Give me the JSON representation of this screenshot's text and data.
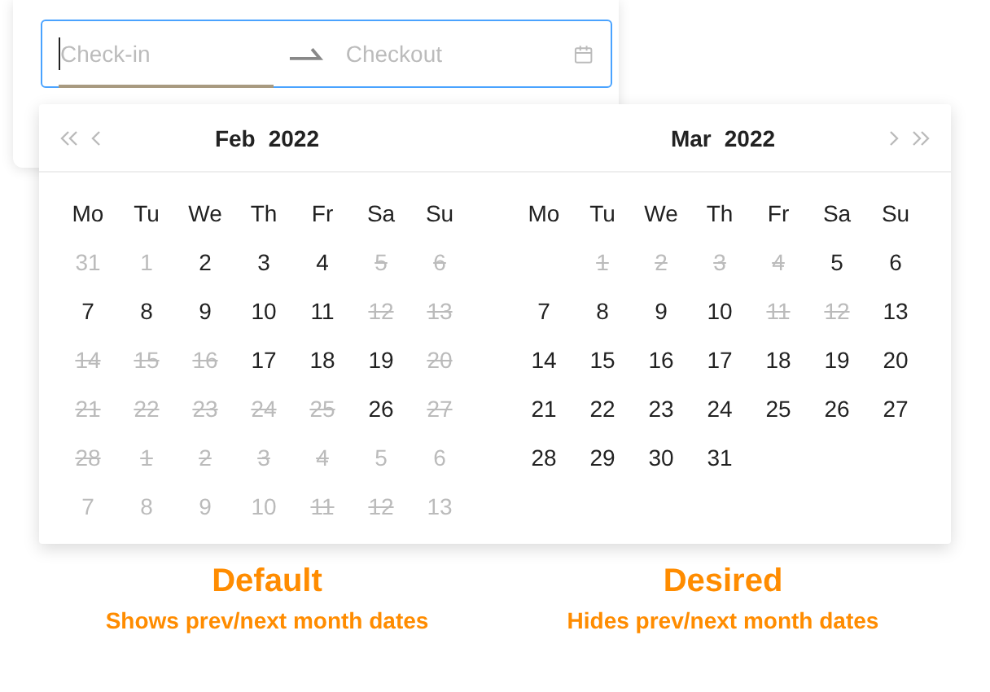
{
  "range_picker": {
    "start": {
      "placeholder": "Check-in",
      "focused": true
    },
    "end": {
      "placeholder": "Checkout",
      "focused": false
    }
  },
  "calendars": [
    {
      "month": "Feb",
      "year": "2022",
      "show_prev": true,
      "weekdays": [
        "Mo",
        "Tu",
        "We",
        "Th",
        "Fr",
        "Sa",
        "Su"
      ],
      "weeks": [
        [
          {
            "text": "31",
            "muted": true,
            "disabled": false
          },
          {
            "text": "1",
            "muted": true,
            "disabled": false
          },
          {
            "text": "2",
            "muted": false,
            "disabled": false
          },
          {
            "text": "3",
            "muted": false,
            "disabled": false
          },
          {
            "text": "4",
            "muted": false,
            "disabled": false
          },
          {
            "text": "5",
            "muted": true,
            "disabled": true
          },
          {
            "text": "6",
            "muted": true,
            "disabled": true
          }
        ],
        [
          {
            "text": "7",
            "muted": false,
            "disabled": false
          },
          {
            "text": "8",
            "muted": false,
            "disabled": false
          },
          {
            "text": "9",
            "muted": false,
            "disabled": false
          },
          {
            "text": "10",
            "muted": false,
            "disabled": false
          },
          {
            "text": "11",
            "muted": false,
            "disabled": false
          },
          {
            "text": "12",
            "muted": true,
            "disabled": true
          },
          {
            "text": "13",
            "muted": true,
            "disabled": true
          }
        ],
        [
          {
            "text": "14",
            "muted": true,
            "disabled": true
          },
          {
            "text": "15",
            "muted": true,
            "disabled": true
          },
          {
            "text": "16",
            "muted": true,
            "disabled": true
          },
          {
            "text": "17",
            "muted": false,
            "disabled": false
          },
          {
            "text": "18",
            "muted": false,
            "disabled": false
          },
          {
            "text": "19",
            "muted": false,
            "disabled": false
          },
          {
            "text": "20",
            "muted": true,
            "disabled": true
          }
        ],
        [
          {
            "text": "21",
            "muted": true,
            "disabled": true
          },
          {
            "text": "22",
            "muted": true,
            "disabled": true
          },
          {
            "text": "23",
            "muted": true,
            "disabled": true
          },
          {
            "text": "24",
            "muted": true,
            "disabled": true
          },
          {
            "text": "25",
            "muted": true,
            "disabled": true
          },
          {
            "text": "26",
            "muted": false,
            "disabled": false
          },
          {
            "text": "27",
            "muted": true,
            "disabled": true
          }
        ],
        [
          {
            "text": "28",
            "muted": true,
            "disabled": true
          },
          {
            "text": "1",
            "muted": true,
            "disabled": true
          },
          {
            "text": "2",
            "muted": true,
            "disabled": true
          },
          {
            "text": "3",
            "muted": true,
            "disabled": true
          },
          {
            "text": "4",
            "muted": true,
            "disabled": true
          },
          {
            "text": "5",
            "muted": true,
            "disabled": false
          },
          {
            "text": "6",
            "muted": true,
            "disabled": false
          }
        ],
        [
          {
            "text": "7",
            "muted": true,
            "disabled": false
          },
          {
            "text": "8",
            "muted": true,
            "disabled": false
          },
          {
            "text": "9",
            "muted": true,
            "disabled": false
          },
          {
            "text": "10",
            "muted": true,
            "disabled": false
          },
          {
            "text": "11",
            "muted": true,
            "disabled": true
          },
          {
            "text": "12",
            "muted": true,
            "disabled": true
          },
          {
            "text": "13",
            "muted": true,
            "disabled": false
          }
        ]
      ]
    },
    {
      "month": "Mar",
      "year": "2022",
      "show_next": true,
      "weekdays": [
        "Mo",
        "Tu",
        "We",
        "Th",
        "Fr",
        "Sa",
        "Su"
      ],
      "weeks": [
        [
          {
            "text": "1",
            "muted": true,
            "disabled": true
          },
          {
            "text": "2",
            "muted": true,
            "disabled": true
          },
          {
            "text": "3",
            "muted": true,
            "disabled": true
          },
          {
            "text": "4",
            "muted": true,
            "disabled": true
          },
          {
            "text": "5",
            "muted": false,
            "disabled": false
          },
          {
            "text": "6",
            "muted": false,
            "disabled": false
          }
        ],
        [
          {
            "text": "7",
            "muted": false,
            "disabled": false
          },
          {
            "text": "8",
            "muted": false,
            "disabled": false
          },
          {
            "text": "9",
            "muted": false,
            "disabled": false
          },
          {
            "text": "10",
            "muted": false,
            "disabled": false
          },
          {
            "text": "11",
            "muted": true,
            "disabled": true
          },
          {
            "text": "12",
            "muted": true,
            "disabled": true
          },
          {
            "text": "13",
            "muted": false,
            "disabled": false
          }
        ],
        [
          {
            "text": "14",
            "muted": false,
            "disabled": false
          },
          {
            "text": "15",
            "muted": false,
            "disabled": false
          },
          {
            "text": "16",
            "muted": false,
            "disabled": false
          },
          {
            "text": "17",
            "muted": false,
            "disabled": false
          },
          {
            "text": "18",
            "muted": false,
            "disabled": false
          },
          {
            "text": "19",
            "muted": false,
            "disabled": false
          },
          {
            "text": "20",
            "muted": false,
            "disabled": false
          }
        ],
        [
          {
            "text": "21",
            "muted": false,
            "disabled": false
          },
          {
            "text": "22",
            "muted": false,
            "disabled": false
          },
          {
            "text": "23",
            "muted": false,
            "disabled": false
          },
          {
            "text": "24",
            "muted": false,
            "disabled": false
          },
          {
            "text": "25",
            "muted": false,
            "disabled": false
          },
          {
            "text": "26",
            "muted": false,
            "disabled": false
          },
          {
            "text": "27",
            "muted": false,
            "disabled": false
          }
        ],
        [
          {
            "text": "28",
            "muted": false,
            "disabled": false
          },
          {
            "text": "29",
            "muted": false,
            "disabled": false
          },
          {
            "text": "30",
            "muted": false,
            "disabled": false
          },
          {
            "text": "31",
            "muted": false,
            "disabled": false
          }
        ]
      ]
    }
  ],
  "captions": [
    {
      "title": "Default",
      "subtitle": "Shows prev/next month dates"
    },
    {
      "title": "Desired",
      "subtitle": "Hides prev/next month dates"
    }
  ]
}
